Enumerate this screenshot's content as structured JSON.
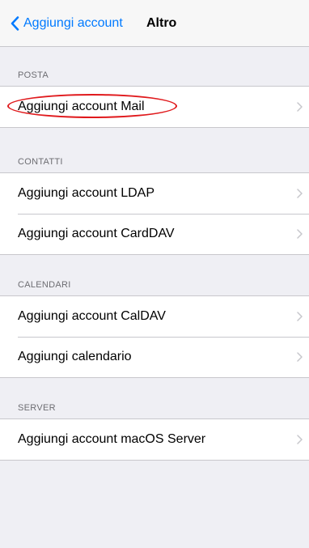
{
  "navbar": {
    "back_label": "Aggiungi account",
    "title": "Altro"
  },
  "sections": [
    {
      "header": "POSTA",
      "items": [
        {
          "label": "Aggiungi account Mail"
        }
      ]
    },
    {
      "header": "CONTATTI",
      "items": [
        {
          "label": "Aggiungi account LDAP"
        },
        {
          "label": "Aggiungi account CardDAV"
        }
      ]
    },
    {
      "header": "CALENDARI",
      "items": [
        {
          "label": "Aggiungi account CalDAV"
        },
        {
          "label": "Aggiungi calendario"
        }
      ]
    },
    {
      "header": "SERVER",
      "items": [
        {
          "label": "Aggiungi account macOS Server"
        }
      ]
    }
  ],
  "colors": {
    "accent": "#007aff",
    "background": "#efeff4",
    "highlight_ring": "#e0191c"
  }
}
